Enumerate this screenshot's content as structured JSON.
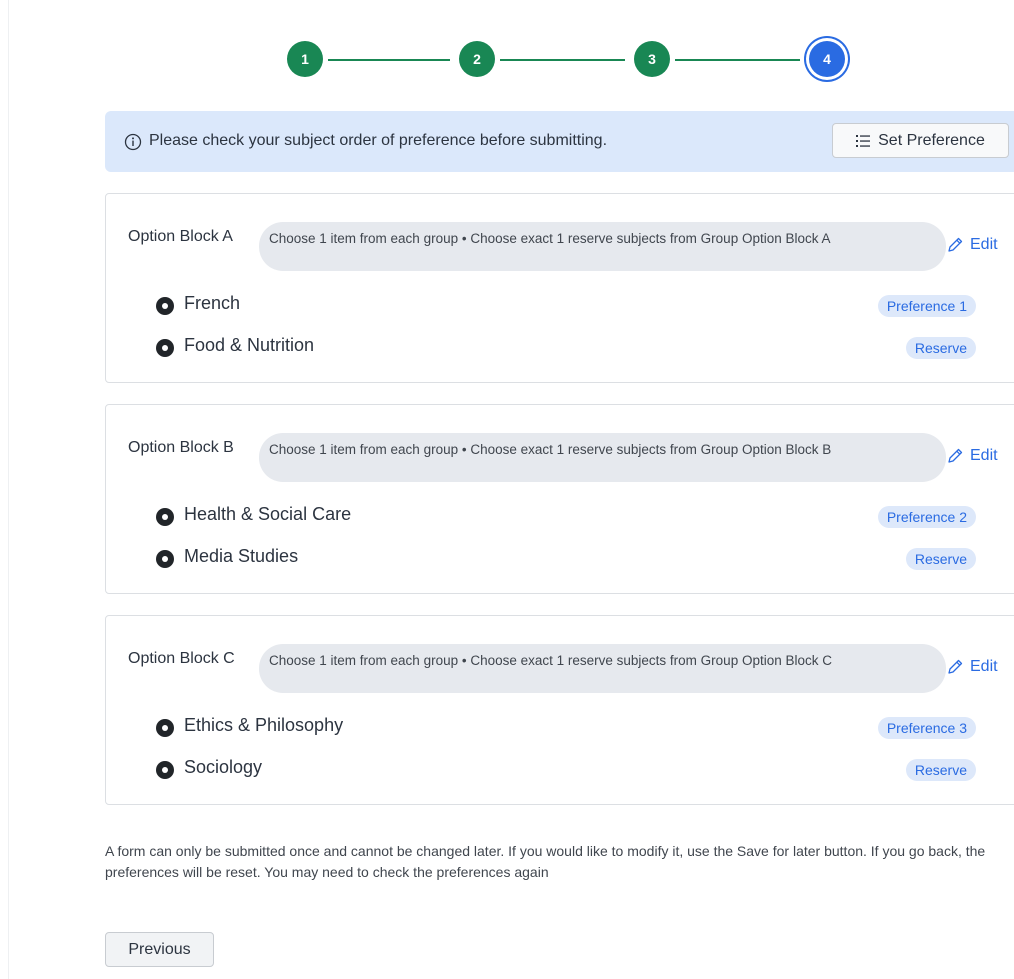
{
  "stepper": {
    "steps": [
      {
        "number": "1",
        "status": "complete"
      },
      {
        "number": "2",
        "status": "complete"
      },
      {
        "number": "3",
        "status": "complete"
      },
      {
        "number": "4",
        "status": "current"
      }
    ],
    "complete_color": "#198754",
    "current_color": "#2a6be2"
  },
  "alert": {
    "icon": "info-icon",
    "message": "Please check your subject order of preference before submitting.",
    "button_label": "Set Preference",
    "button_icon": "ordered-list-icon"
  },
  "blocks": [
    {
      "title": "Option Block A",
      "rule": "Choose 1 item from each group • Choose exact 1 reserve subjects from Group Option Block A",
      "edit_label": "Edit",
      "subjects": [
        {
          "name": "French",
          "badge": "Preference 1"
        },
        {
          "name": "Food & Nutrition",
          "badge": "Reserve"
        }
      ]
    },
    {
      "title": "Option Block B",
      "rule": "Choose 1 item from each group • Choose exact 1 reserve subjects from Group Option Block B",
      "edit_label": "Edit",
      "subjects": [
        {
          "name": "Health & Social Care",
          "badge": "Preference 2"
        },
        {
          "name": "Media Studies",
          "badge": "Reserve"
        }
      ]
    },
    {
      "title": "Option Block C",
      "rule": "Choose 1 item from each group • Choose exact 1 reserve subjects from Group Option Block C",
      "edit_label": "Edit",
      "subjects": [
        {
          "name": "Ethics & Philosophy",
          "badge": "Preference 3"
        },
        {
          "name": "Sociology",
          "badge": "Reserve"
        }
      ]
    }
  ],
  "footer": {
    "notice": "A form can only be submitted once and cannot be changed later. If you would like to modify it, use the Save for later button. If you go back, the preferences will be reset. You may need to check the preferences again",
    "previous_label": "Previous"
  }
}
